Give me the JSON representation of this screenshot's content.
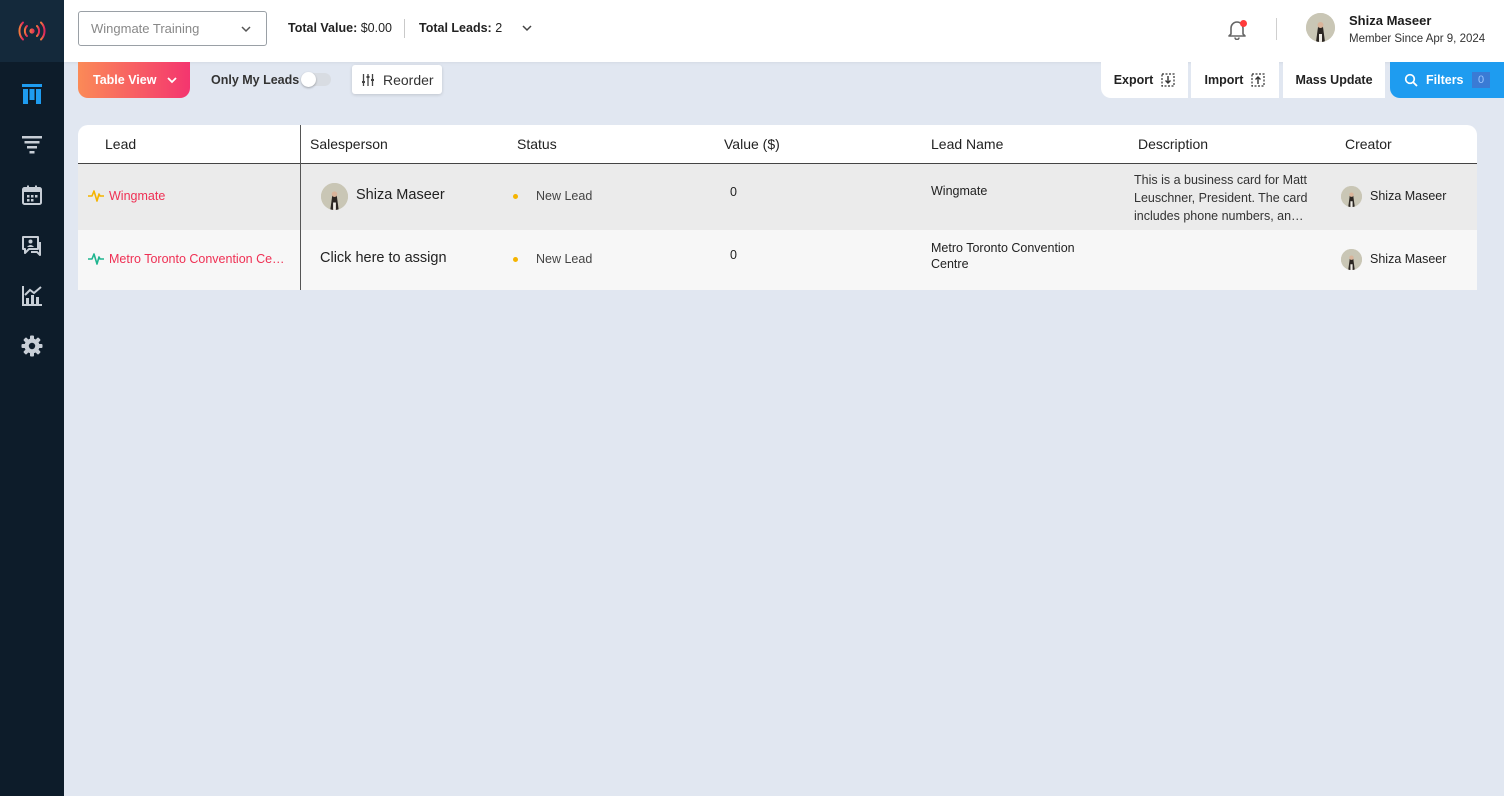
{
  "sidebar": {
    "logo": "broadcast-logo",
    "items": [
      {
        "icon": "kanban-board-icon",
        "active": true
      },
      {
        "icon": "funnel-icon",
        "active": false
      },
      {
        "icon": "calendar-icon",
        "active": false
      },
      {
        "icon": "chat-user-icon",
        "active": false
      },
      {
        "icon": "analytics-chart-icon",
        "active": false
      },
      {
        "icon": "gear-icon",
        "active": false
      }
    ]
  },
  "header": {
    "pipeline_placeholder": "Wingmate Training",
    "total_value_label": "Total Value:",
    "total_value": "$0.00",
    "total_leads_label": "Total Leads:",
    "total_leads": "2",
    "user": {
      "name": "Shiza Maseer",
      "since": "Member Since Apr 9, 2024"
    }
  },
  "toolbar": {
    "view_label": "Table View",
    "only_my_leads_label": "Only My Leads",
    "only_my_leads_on": false,
    "reorder_label": "Reorder",
    "export_label": "Export",
    "import_label": "Import",
    "mass_update_label": "Mass Update",
    "filters_label": "Filters",
    "filters_count": "0"
  },
  "table": {
    "columns": [
      "Lead",
      "Salesperson",
      "Status",
      "Value ($)",
      "Lead Name",
      "Description",
      "Creator"
    ],
    "rows": [
      {
        "lead": "Wingmate",
        "salesperson": "Shiza Maseer",
        "status": "New Lead",
        "value": "0",
        "lead_name": "Wingmate",
        "description": "This is a business card for Matt Leuschner, President. The card includes phone numbers, an…",
        "creator": "Shiza Maseer"
      },
      {
        "lead": "Metro Toronto Convention Ce…",
        "salesperson": "Click here to assign",
        "status": "New Lead",
        "value": "0",
        "lead_name": "Metro Toronto Convention Centre",
        "description": "",
        "creator": "Shiza Maseer"
      }
    ]
  },
  "colors": {
    "accent_gradient_start": "#fb8a57",
    "accent_gradient_end": "#f4356f",
    "filters_blue": "#1e9cf0",
    "lead_link": "#ef3054",
    "status_new": "#f5b400",
    "sidebar_bg": "#0d1c2a"
  }
}
